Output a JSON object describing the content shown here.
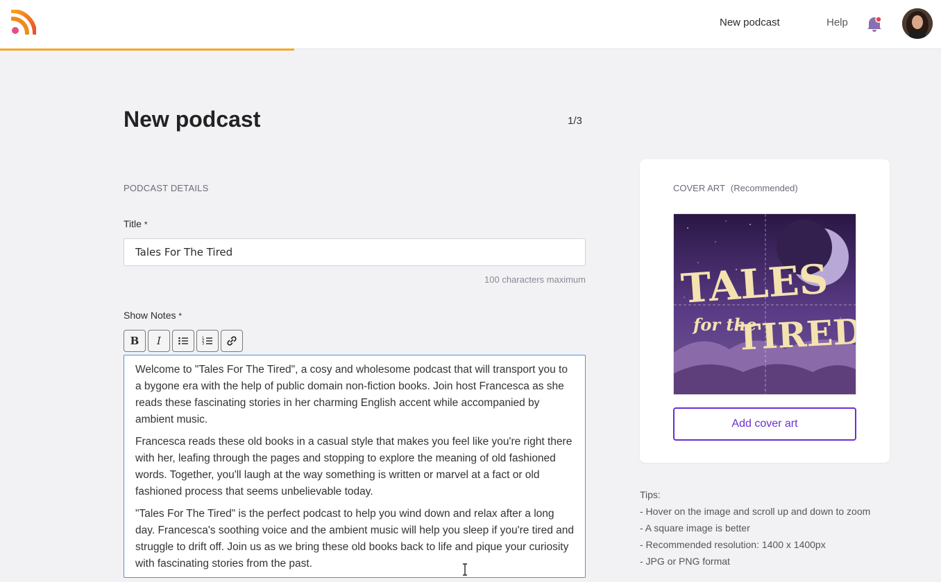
{
  "header": {
    "nav_new_podcast": "New podcast",
    "nav_help": "Help"
  },
  "page": {
    "title": "New podcast",
    "step": "1/3"
  },
  "form": {
    "section_label": "PODCAST DETAILS",
    "title_label": "Title",
    "required_mark": "*",
    "title_value": "Tales For The Tired",
    "title_hint": "100 characters maximum",
    "notes_label": "Show Notes",
    "notes_paragraphs": [
      "Welcome to \"Tales For The Tired\", a cosy and wholesome podcast that will transport you to a bygone era with the help of public domain non-fiction books. Join host Francesca as she reads these fascinating stories in her charming English accent while accompanied by ambient music.",
      "Francesca reads these old books in a casual style that makes you feel like you're right there with her, leafing through the pages and stopping to explore the meaning of old fashioned words. Together, you'll laugh at the way something is written or marvel at a fact or old fashioned process that seems unbelievable today.",
      "\"Tales For The Tired\" is the perfect podcast to help you wind down and relax after a long day. Francesca's soothing voice and the ambient music will help you sleep if you're tired and struggle to drift off. Join us as we bring these old books back to life and pique your curiosity with fascinating stories from the past."
    ],
    "toolbar": {
      "bold": "B",
      "italic": "I"
    }
  },
  "cover": {
    "label": "COVER ART",
    "recommended": "(Recommended)",
    "art_line1": "TALES",
    "art_line2": "for the",
    "art_line3": "TIRED",
    "button": "Add cover art"
  },
  "tips": {
    "heading": "Tips:",
    "items": [
      "- Hover on the image and scroll up and down to zoom",
      "- A square image is better",
      "- Recommended resolution: 1400 x 1400px",
      "- JPG or PNG format"
    ]
  },
  "colors": {
    "progress": "#f5a623",
    "accent": "#6a2fd1",
    "focus": "#4a90e2"
  }
}
